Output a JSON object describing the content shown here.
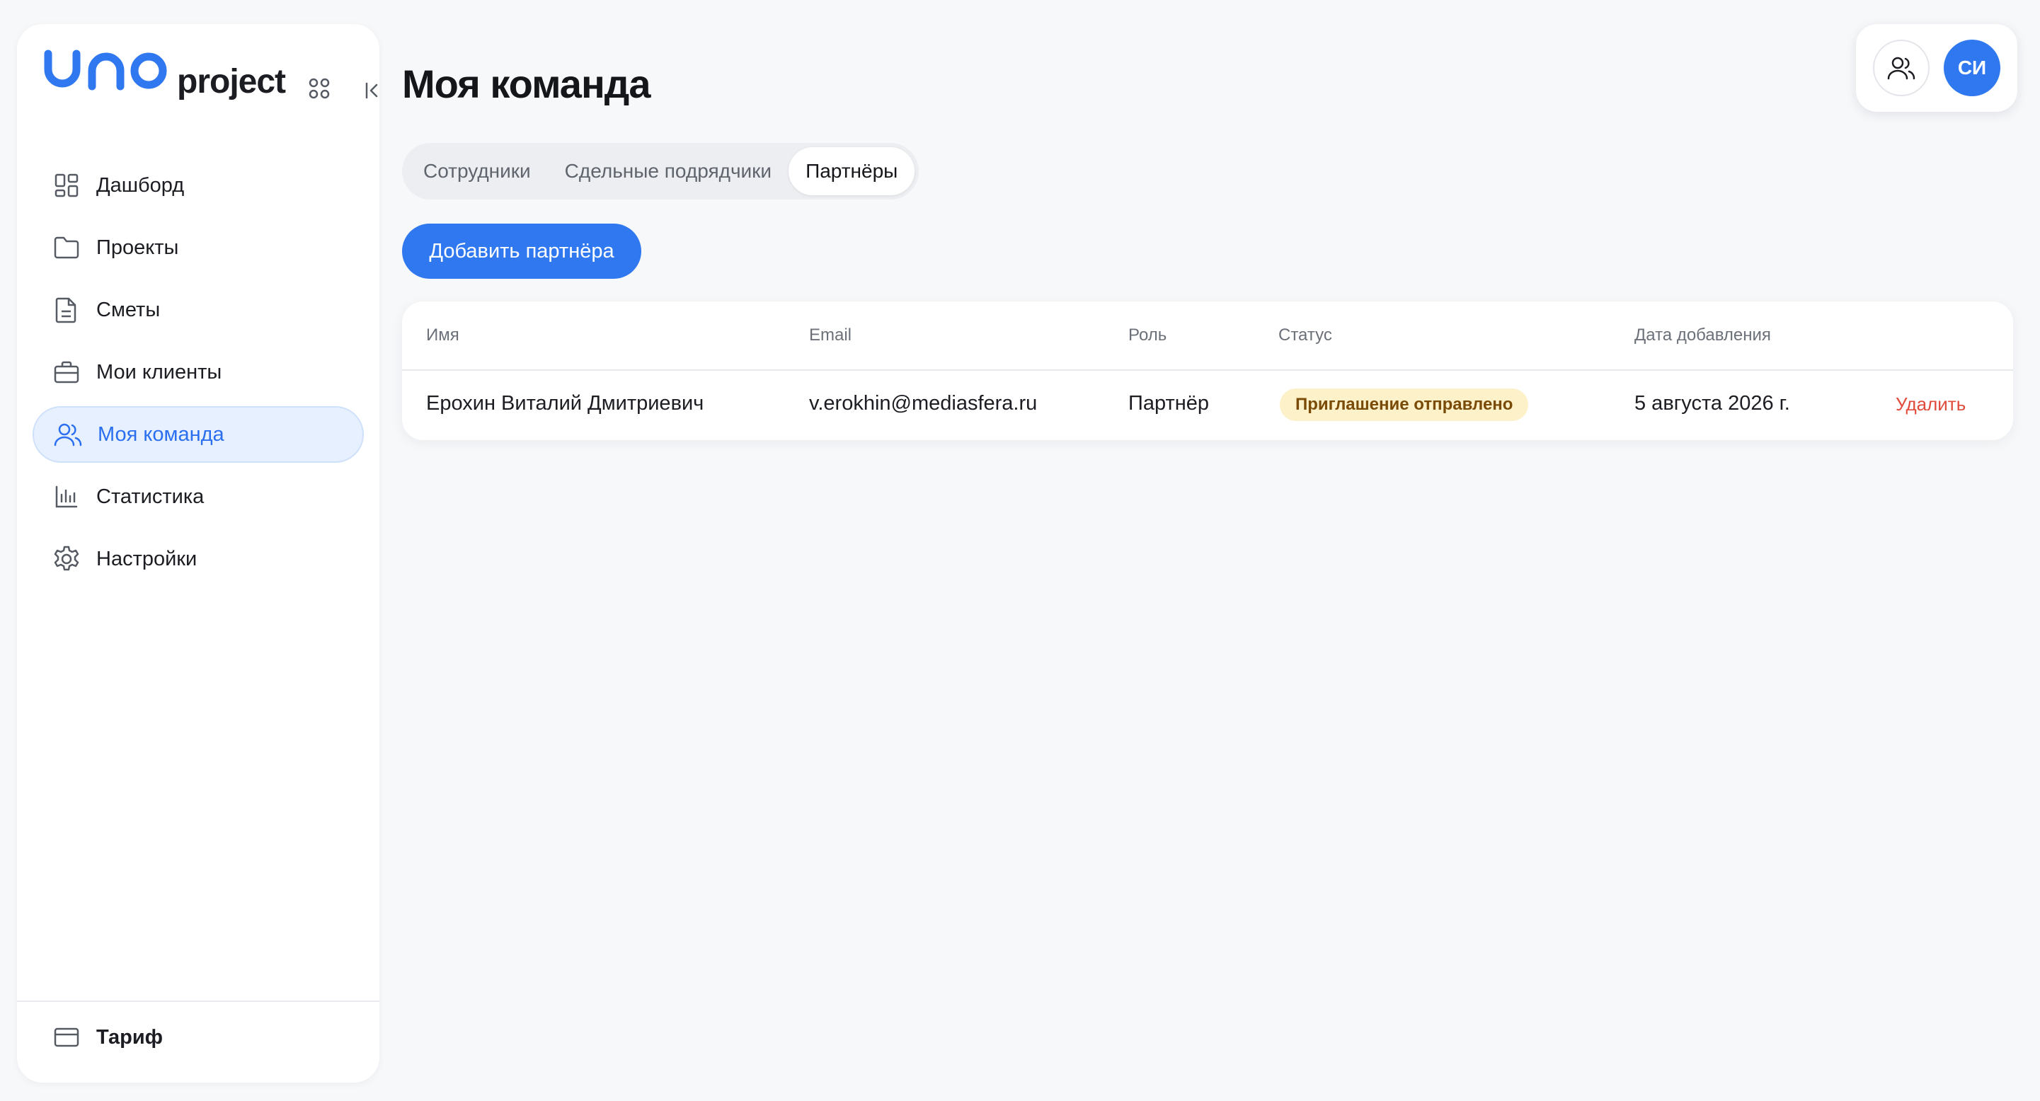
{
  "app": {
    "logo_text": "project",
    "accent": "#2f78ef"
  },
  "sidebar": {
    "items": [
      {
        "label": "Дашборд",
        "icon": "dashboard-icon"
      },
      {
        "label": "Проекты",
        "icon": "folder-icon"
      },
      {
        "label": "Сметы",
        "icon": "document-icon"
      },
      {
        "label": "Мои клиенты",
        "icon": "briefcase-icon"
      },
      {
        "label": "Моя команда",
        "icon": "users-icon",
        "active": true
      },
      {
        "label": "Статистика",
        "icon": "bar-chart-icon"
      },
      {
        "label": "Настройки",
        "icon": "gear-icon"
      }
    ],
    "footer": {
      "label": "Тариф",
      "icon": "credit-card-icon"
    }
  },
  "page": {
    "title": "Моя команда",
    "tabs": [
      {
        "label": "Сотрудники"
      },
      {
        "label": "Сдельные подрядчики"
      },
      {
        "label": "Партнёры",
        "active": true
      }
    ],
    "add_button": "Добавить партнёра"
  },
  "table": {
    "columns": [
      "Имя",
      "Email",
      "Роль",
      "Статус",
      "Дата добавления"
    ],
    "rows": [
      {
        "name": "Ерохин Виталий Дмитриевич",
        "email": "v.erokhin@mediasfera.ru",
        "role": "Партнёр",
        "status": "Приглашение отправлено",
        "date": "5 августа 2026 г.",
        "action": "Удалить"
      }
    ]
  },
  "header": {
    "avatar_initials": "СИ"
  }
}
